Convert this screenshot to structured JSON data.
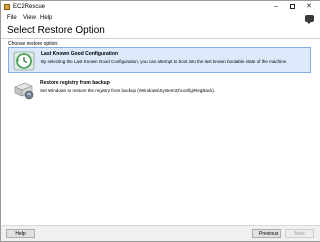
{
  "window": {
    "title": "EC2Rescue"
  },
  "menu": {
    "file": "File",
    "view": "View",
    "help": "Help"
  },
  "header": {
    "title": "Select Restore Option"
  },
  "content": {
    "section_label": "Choose restore option:",
    "options": [
      {
        "title": "Last Known Good Configuration",
        "description": "By selecting the Last Known Good Configuration, you can attempt to boot into the last known bootable state of the machine.",
        "icon": "restore-clock-icon",
        "selected": true
      },
      {
        "title": "Restore registry from backup",
        "description": "Set Windows to restore the registry from backup (\\Windows\\System32\\config\\RegBack).",
        "icon": "drive-backup-icon",
        "selected": false
      }
    ]
  },
  "footer": {
    "help": "Help",
    "previous": "Previous",
    "next": "Next"
  },
  "colors": {
    "selection_bg": "#dbe9fb",
    "selection_border": "#84aee3",
    "footer_bg": "#f0f0f0"
  }
}
